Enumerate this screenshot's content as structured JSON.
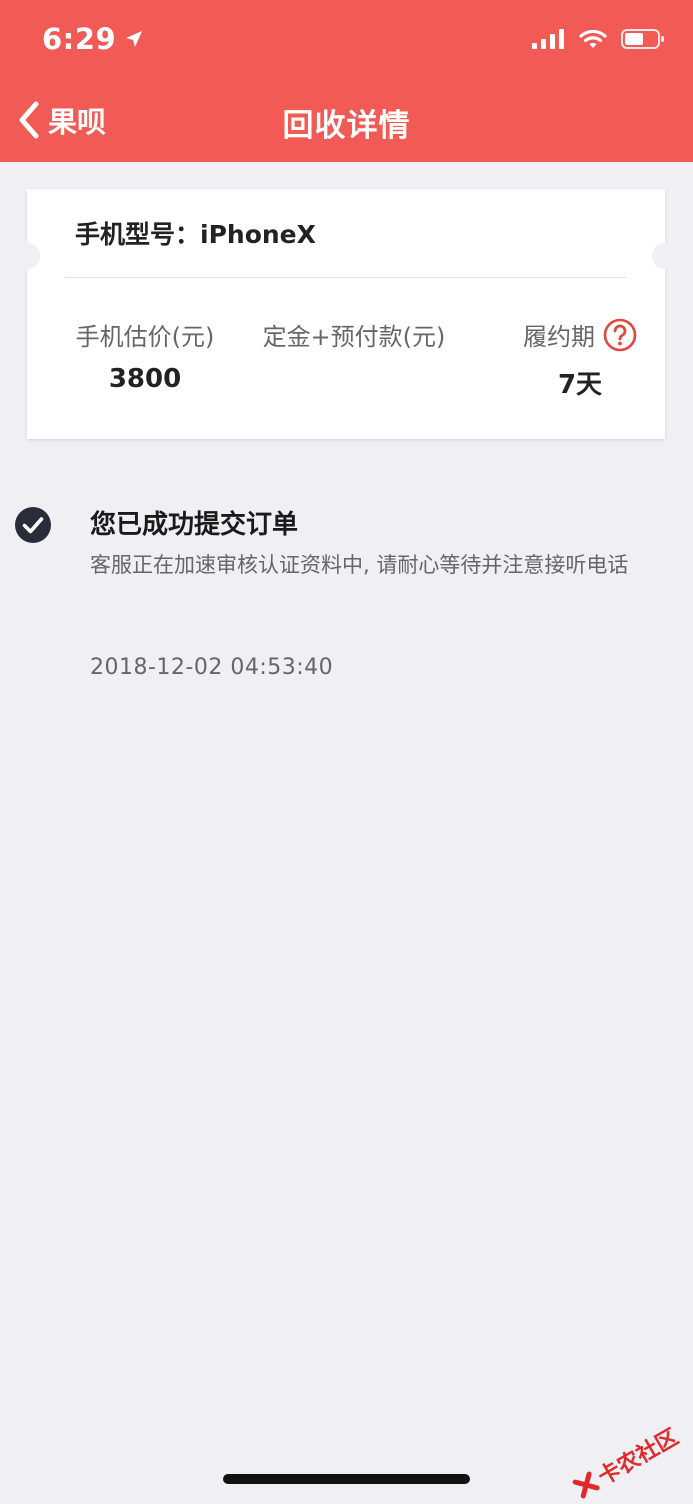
{
  "status_bar": {
    "time": "6:29"
  },
  "nav": {
    "back_label": "果呗",
    "title": "回收详情"
  },
  "card": {
    "model_label": "手机型号：",
    "model_value": "iPhoneX",
    "columns": [
      {
        "label": "手机估价(元)",
        "value": "3800"
      },
      {
        "label": "定金+预付款(元)",
        "value": ""
      },
      {
        "label": "履约期",
        "value": "7天"
      }
    ]
  },
  "status": {
    "title": "您已成功提交订单",
    "description": "客服正在加速审核认证资料中, 请耐心等待并注意接听电话",
    "timestamp": "2018-12-02 04:53:40"
  },
  "watermark": {
    "text": "卡农社区"
  },
  "colors": {
    "header": "#f25a55",
    "background": "#efeff4",
    "help_icon": "#e0473f",
    "check_icon": "#2b2b3a"
  },
  "icons": {
    "location": "location-arrow-icon",
    "signal": "cellular-signal-icon",
    "wifi": "wifi-icon",
    "battery": "battery-icon",
    "back": "chevron-left-icon",
    "help": "question-circle-icon",
    "check": "check-circle-icon"
  }
}
